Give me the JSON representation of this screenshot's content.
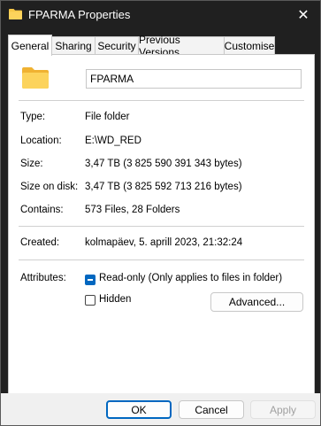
{
  "window": {
    "title": "FPARMA Properties",
    "close_glyph": "✕"
  },
  "tabs": [
    {
      "label": "General",
      "active": true
    },
    {
      "label": "Sharing"
    },
    {
      "label": "Security"
    },
    {
      "label": "Previous Versions"
    },
    {
      "label": "Customise"
    }
  ],
  "general": {
    "name_value": "FPARMA",
    "type_label": "Type:",
    "type_value": "File folder",
    "location_label": "Location:",
    "location_value": "E:\\WD_RED",
    "size_label": "Size:",
    "size_value": "3,47 TB (3 825 590 391 343 bytes)",
    "size_on_disk_label": "Size on disk:",
    "size_on_disk_value": "3,47 TB (3 825 592 713 216 bytes)",
    "contains_label": "Contains:",
    "contains_value": "573 Files, 28 Folders",
    "created_label": "Created:",
    "created_value": "kolmapäev, 5. aprill 2023, 21:32:24",
    "attributes_label": "Attributes:",
    "readonly_label": "Read-only (Only applies to files in folder)",
    "hidden_label": "Hidden",
    "advanced_button": "Advanced..."
  },
  "footer": {
    "ok": "OK",
    "cancel": "Cancel",
    "apply": "Apply"
  },
  "colors": {
    "accent": "#0067c0",
    "folder": "#f8c848",
    "titlebar": "#202020"
  },
  "icons": {
    "title": "folder-icon",
    "main": "folder-icon"
  }
}
